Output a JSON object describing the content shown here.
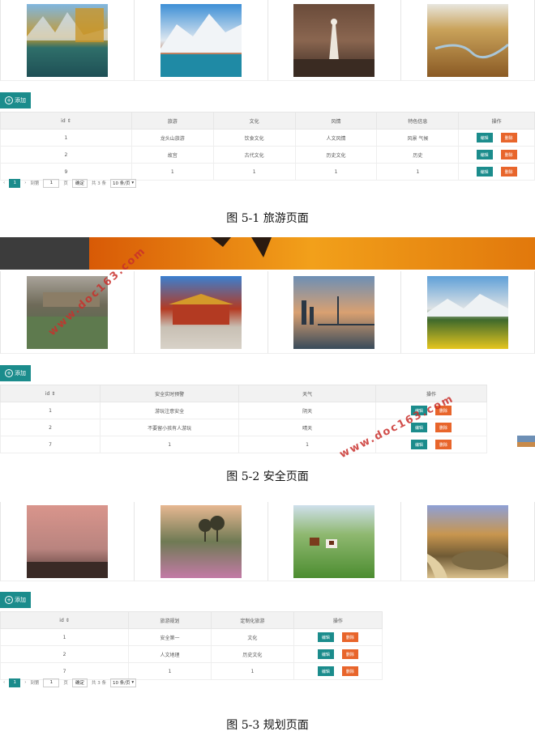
{
  "add_label": "添加",
  "edit_label": "编辑",
  "delete_label": "删除",
  "watermark_text": "www.doc163.com",
  "tourism": {
    "photos": [
      "lake-forest-mountain",
      "snow-mountain-river",
      "white-pagoda",
      "autumn-wetland"
    ],
    "columns": [
      "id",
      "旅游",
      "文化",
      "风情",
      "特色信息",
      "操作"
    ],
    "rows": [
      {
        "id": "1",
        "c1": "龙头山旅游",
        "c2": "饮食文化",
        "c3": "人文风情",
        "c4": "风景 气候"
      },
      {
        "id": "2",
        "c1": "故宫",
        "c2": "古代文化",
        "c3": "历史文化",
        "c4": "历史"
      },
      {
        "id": "9",
        "c1": "1",
        "c2": "1",
        "c3": "1",
        "c4": "1"
      }
    ],
    "pager": {
      "current": "1",
      "goto_label": "到第",
      "goto_value": "1",
      "page_unit": "页",
      "confirm": "确定",
      "total": "共 3 条",
      "page_size": "10 条/页"
    },
    "caption": "图 5-1 旅游页面"
  },
  "safety": {
    "photos": [
      "village-lotus-pond",
      "red-gate-temple",
      "city-bridge-sunset",
      "snow-mountain-flowers"
    ],
    "columns": [
      "id",
      "安全实时预警",
      "天气",
      "操作"
    ],
    "rows": [
      {
        "id": "1",
        "c1": "游玩注意安全",
        "c2": "阴天"
      },
      {
        "id": "2",
        "c1": "不要留小孩有人游玩",
        "c2": "晴天"
      },
      {
        "id": "7",
        "c1": "1",
        "c2": "1"
      }
    ],
    "caption": "图 5-2 安全页面"
  },
  "planning": {
    "photos": [
      "pink-sky-valley",
      "flower-field-trees",
      "horses-grassland",
      "desert-lake-boardwalk"
    ],
    "columns": [
      "id",
      "旅游规划",
      "定制化旅游",
      "操作"
    ],
    "rows": [
      {
        "id": "1",
        "c1": "安全第一",
        "c2": "文化"
      },
      {
        "id": "2",
        "c1": "人文地理",
        "c2": "历史文化"
      },
      {
        "id": "7",
        "c1": "1",
        "c2": "1"
      }
    ],
    "pager": {
      "current": "1",
      "goto_label": "到第",
      "goto_value": "1",
      "page_unit": "页",
      "confirm": "确定",
      "total": "共 3 条",
      "page_size": "10 条/页"
    },
    "caption": "图 5-3 规划页面"
  }
}
